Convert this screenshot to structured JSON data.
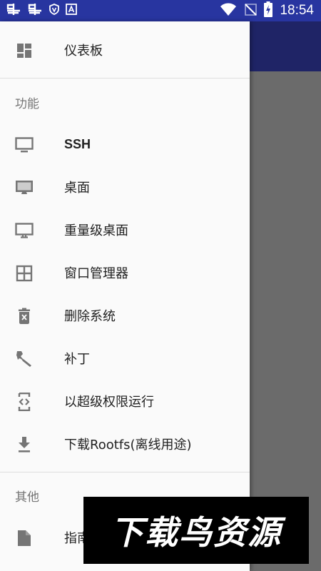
{
  "status_bar": {
    "time": "18:54",
    "left_icons": [
      "notification-icon",
      "notification-icon",
      "shield-icon",
      "app-notification-icon"
    ],
    "right_icons": [
      "wifi-icon",
      "no-sim-icon",
      "battery-charging-icon"
    ]
  },
  "colors": {
    "status_bar": "#2835a0",
    "app_bar": "#1f2466",
    "drawer_bg": "#fafafa",
    "scrim": "#6b6b6b",
    "icon": "#757575",
    "text_primary": "#212121",
    "text_secondary": "#757575"
  },
  "drawer": {
    "top_item": {
      "label": "仪表板",
      "icon": "dashboard-icon"
    },
    "section_features": {
      "title": "功能",
      "items": [
        {
          "label": "SSH",
          "icon": "desktop-icon"
        },
        {
          "label": "桌面",
          "icon": "desktop-stand-icon"
        },
        {
          "label": "重量级桌面",
          "icon": "monitor-icon"
        },
        {
          "label": "窗口管理器",
          "icon": "window-grid-icon"
        },
        {
          "label": "删除系统",
          "icon": "delete-icon"
        },
        {
          "label": "补丁",
          "icon": "wrench-icon"
        },
        {
          "label": "以超级权限运行",
          "icon": "code-phone-icon"
        },
        {
          "label": "下载Rootfs(离线用途)",
          "icon": "download-icon"
        }
      ]
    },
    "section_other": {
      "title": "其他",
      "items": [
        {
          "label": "指南",
          "icon": "document-icon"
        }
      ]
    }
  },
  "watermark": {
    "text": "下载鸟资源"
  }
}
